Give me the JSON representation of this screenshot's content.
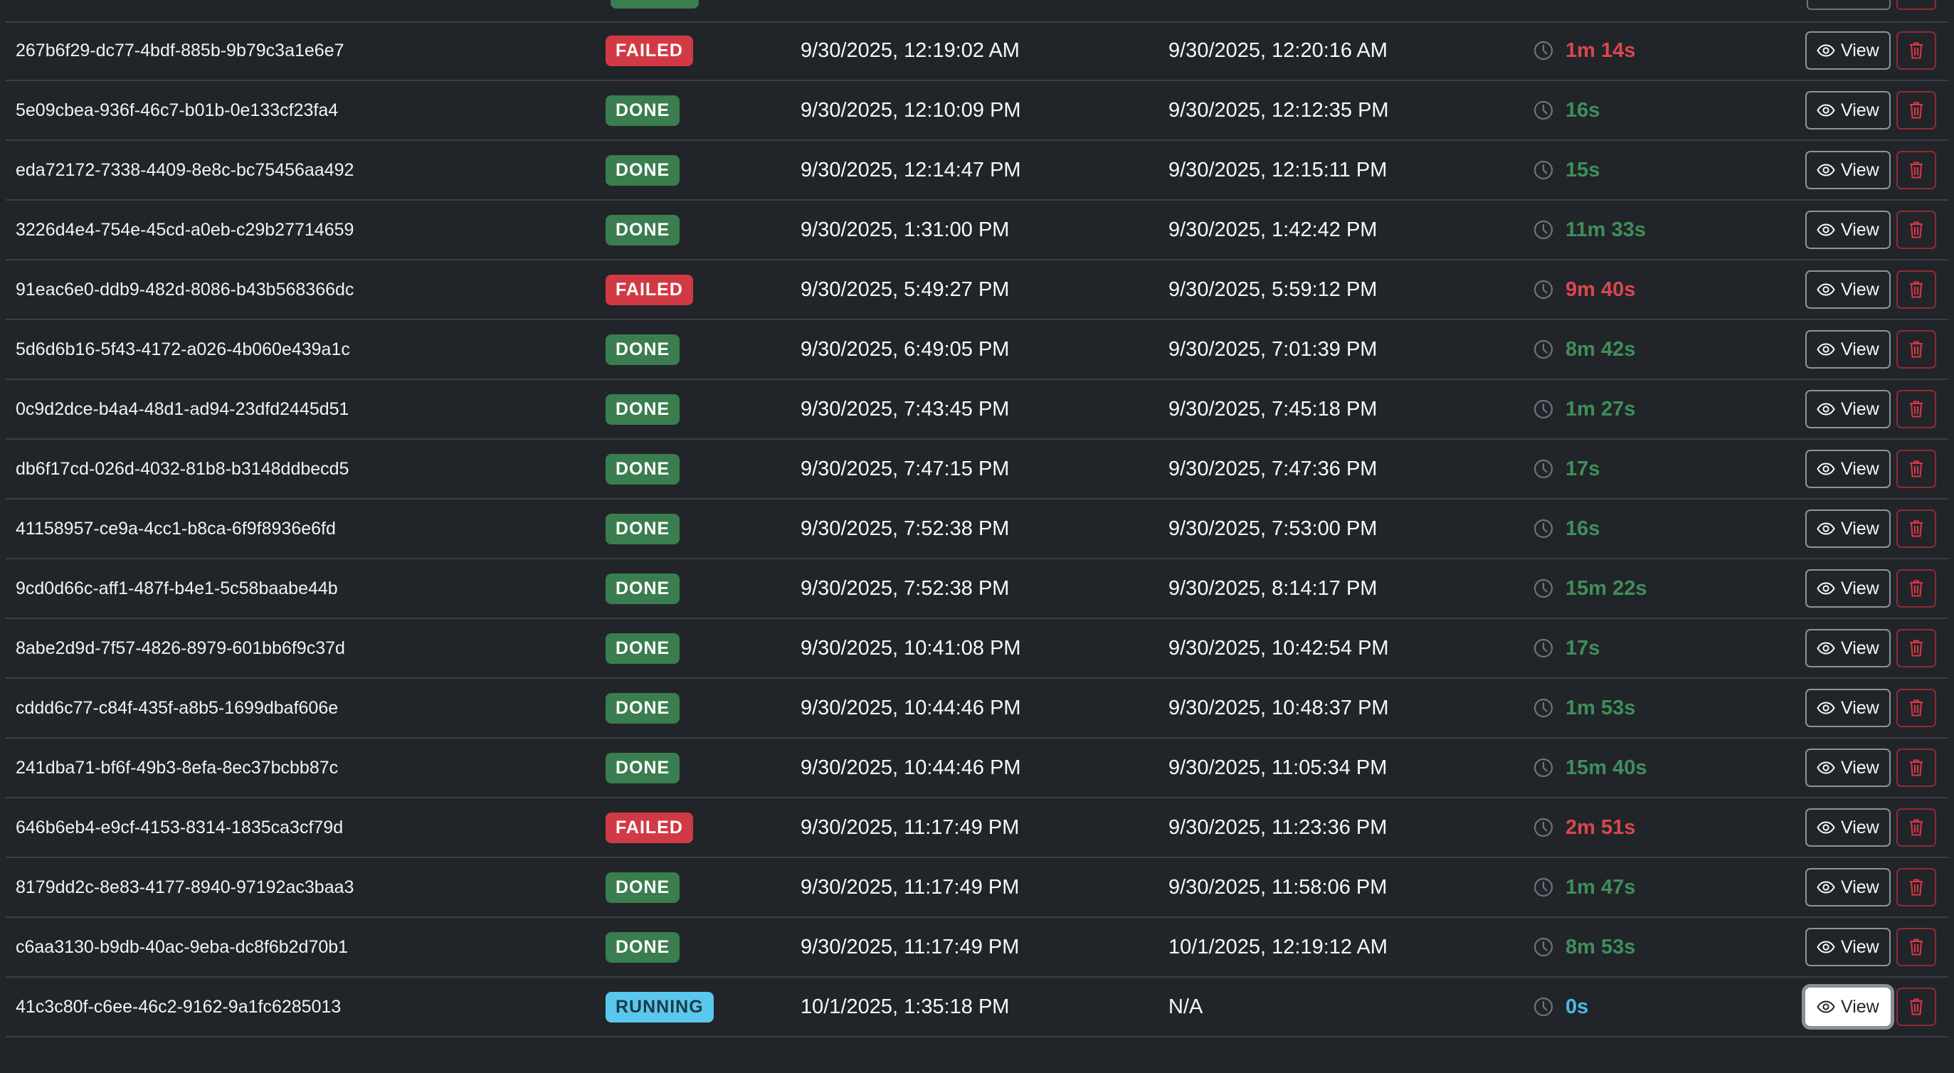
{
  "actions": {
    "view_label": "View"
  },
  "colors": {
    "done_badge": "#3a7d4f",
    "failed_badge": "#d13a45",
    "running_badge": "#5ac8ee",
    "done_duration": "#3f8f5a",
    "failed_duration": "#dc4650",
    "running_duration": "#4fb9e3",
    "delete_border": "#8f2b33"
  },
  "icons": {
    "duration": "clock-icon",
    "view": "eye-icon",
    "delete": "trash-icon"
  },
  "rows": [
    {
      "id": "267b6f29-dc77-4bdf-885b-9b79c3a1e6e7",
      "status": "FAILED",
      "start": "9/30/2025, 12:19:02 AM",
      "end": "9/30/2025, 12:20:16 AM",
      "duration": "1m 14s"
    },
    {
      "id": "5e09cbea-936f-46c7-b01b-0e133cf23fa4",
      "status": "DONE",
      "start": "9/30/2025, 12:10:09 PM",
      "end": "9/30/2025, 12:12:35 PM",
      "duration": "16s"
    },
    {
      "id": "eda72172-7338-4409-8e8c-bc75456aa492",
      "status": "DONE",
      "start": "9/30/2025, 12:14:47 PM",
      "end": "9/30/2025, 12:15:11 PM",
      "duration": "15s"
    },
    {
      "id": "3226d4e4-754e-45cd-a0eb-c29b27714659",
      "status": "DONE",
      "start": "9/30/2025, 1:31:00 PM",
      "end": "9/30/2025, 1:42:42 PM",
      "duration": "11m 33s"
    },
    {
      "id": "91eac6e0-ddb9-482d-8086-b43b568366dc",
      "status": "FAILED",
      "start": "9/30/2025, 5:49:27 PM",
      "end": "9/30/2025, 5:59:12 PM",
      "duration": "9m 40s"
    },
    {
      "id": "5d6d6b16-5f43-4172-a026-4b060e439a1c",
      "status": "DONE",
      "start": "9/30/2025, 6:49:05 PM",
      "end": "9/30/2025, 7:01:39 PM",
      "duration": "8m 42s"
    },
    {
      "id": "0c9d2dce-b4a4-48d1-ad94-23dfd2445d51",
      "status": "DONE",
      "start": "9/30/2025, 7:43:45 PM",
      "end": "9/30/2025, 7:45:18 PM",
      "duration": "1m 27s"
    },
    {
      "id": "db6f17cd-026d-4032-81b8-b3148ddbecd5",
      "status": "DONE",
      "start": "9/30/2025, 7:47:15 PM",
      "end": "9/30/2025, 7:47:36 PM",
      "duration": "17s"
    },
    {
      "id": "41158957-ce9a-4cc1-b8ca-6f9f8936e6fd",
      "status": "DONE",
      "start": "9/30/2025, 7:52:38 PM",
      "end": "9/30/2025, 7:53:00 PM",
      "duration": "16s"
    },
    {
      "id": "9cd0d66c-aff1-487f-b4e1-5c58baabe44b",
      "status": "DONE",
      "start": "9/30/2025, 7:52:38 PM",
      "end": "9/30/2025, 8:14:17 PM",
      "duration": "15m 22s"
    },
    {
      "id": "8abe2d9d-7f57-4826-8979-601bb6f9c37d",
      "status": "DONE",
      "start": "9/30/2025, 10:41:08 PM",
      "end": "9/30/2025, 10:42:54 PM",
      "duration": "17s"
    },
    {
      "id": "cddd6c77-c84f-435f-a8b5-1699dbaf606e",
      "status": "DONE",
      "start": "9/30/2025, 10:44:46 PM",
      "end": "9/30/2025, 10:48:37 PM",
      "duration": "1m 53s"
    },
    {
      "id": "241dba71-bf6f-49b3-8efa-8ec37bcbb87c",
      "status": "DONE",
      "start": "9/30/2025, 10:44:46 PM",
      "end": "9/30/2025, 11:05:34 PM",
      "duration": "15m 40s"
    },
    {
      "id": "646b6eb4-e9cf-4153-8314-1835ca3cf79d",
      "status": "FAILED",
      "start": "9/30/2025, 11:17:49 PM",
      "end": "9/30/2025, 11:23:36 PM",
      "duration": "2m 51s"
    },
    {
      "id": "8179dd2c-8e83-4177-8940-97192ac3baa3",
      "status": "DONE",
      "start": "9/30/2025, 11:17:49 PM",
      "end": "9/30/2025, 11:58:06 PM",
      "duration": "1m 47s"
    },
    {
      "id": "c6aa3130-b9db-40ac-9eba-dc8f6b2d70b1",
      "status": "DONE",
      "start": "9/30/2025, 11:17:49 PM",
      "end": "10/1/2025, 12:19:12 AM",
      "duration": "8m 53s"
    },
    {
      "id": "41c3c80f-c6ee-46c2-9162-9a1fc6285013",
      "status": "RUNNING",
      "start": "10/1/2025, 1:35:18 PM",
      "end": "N/A",
      "duration": "0s",
      "focused": true
    }
  ]
}
